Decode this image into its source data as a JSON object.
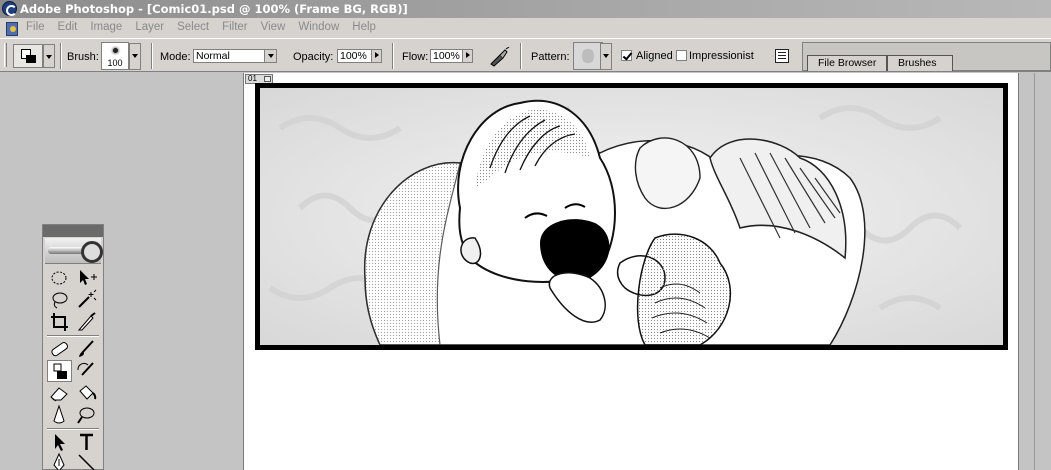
{
  "window": {
    "title": "Adobe Photoshop - [Comic01.psd @ 100% (Frame BG, RGB)]"
  },
  "menu": [
    "File",
    "Edit",
    "Image",
    "Layer",
    "Select",
    "Filter",
    "View",
    "Window",
    "Help"
  ],
  "options": {
    "brush_label": "Brush:",
    "brush_size": "100",
    "mode_label": "Mode:",
    "mode_value": "Normal",
    "opacity_label": "Opacity:",
    "opacity_value": "100%",
    "flow_label": "Flow:",
    "flow_value": "100%",
    "pattern_label": "Pattern:",
    "aligned_label": "Aligned",
    "aligned_checked": true,
    "impressionist_label": "Impressionist",
    "impressionist_checked": false
  },
  "palette_well": {
    "tabs": [
      "File Browser",
      "Brushes"
    ]
  },
  "document": {
    "tab_label": "01",
    "layer": "Frame BG"
  },
  "toolbox": {
    "tools": [
      "marquee-tool",
      "move-tool",
      "lasso-tool",
      "magic-wand-tool",
      "crop-tool",
      "slice-tool",
      "healing-brush-tool",
      "brush-tool",
      "clone-stamp-tool",
      "history-brush-tool",
      "eraser-tool",
      "paint-bucket-tool",
      "blur-tool",
      "dodge-tool",
      "path-selection-tool",
      "type-tool",
      "pen-tool",
      "line-tool"
    ],
    "selected": "clone-stamp-tool"
  }
}
